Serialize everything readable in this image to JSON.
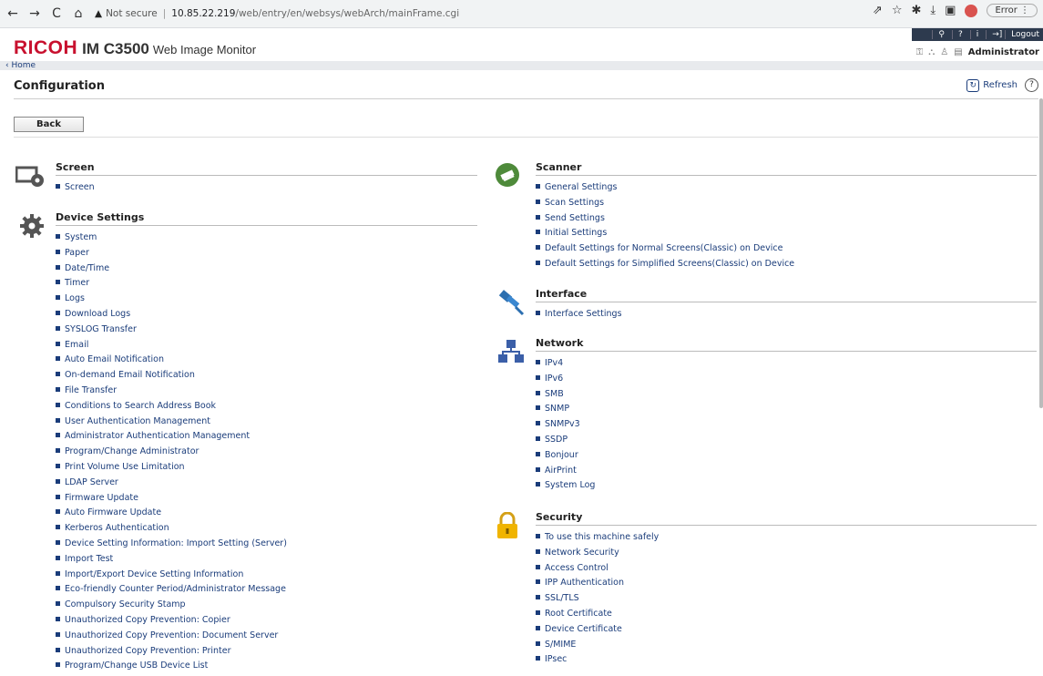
{
  "browser": {
    "not_secure": "Not secure",
    "host": "10.85.22.219",
    "path": "/web/entry/en/websys/webArch/mainFrame.cgi",
    "error_label": "Error"
  },
  "header": {
    "brand": "RICOH",
    "model": "IM C3500",
    "product": "Web Image Monitor",
    "logout": "Logout",
    "user": "Administrator"
  },
  "breadcrumb": "‹ Home",
  "page": {
    "title": "Configuration",
    "refresh": "Refresh",
    "back": "Back"
  },
  "sections": {
    "screen": {
      "title": "Screen",
      "items": [
        "Screen"
      ]
    },
    "device": {
      "title": "Device Settings",
      "items": [
        "System",
        "Paper",
        "Date/Time",
        "Timer",
        "Logs",
        "Download Logs",
        "SYSLOG Transfer",
        "Email",
        "Auto Email Notification",
        "On-demand Email Notification",
        "File Transfer",
        "Conditions to Search Address Book",
        "User Authentication Management",
        "Administrator Authentication Management",
        "Program/Change Administrator",
        "Print Volume Use Limitation",
        "LDAP Server",
        "Firmware Update",
        "Auto Firmware Update",
        "Kerberos Authentication",
        "Device Setting Information: Import Setting (Server)",
        "Import Test",
        "Import/Export Device Setting Information",
        "Eco-friendly Counter Period/Administrator Message",
        "Compulsory Security Stamp",
        "Unauthorized Copy Prevention: Copier",
        "Unauthorized Copy Prevention: Document Server",
        "Unauthorized Copy Prevention: Printer",
        "Program/Change USB Device List"
      ]
    },
    "scanner": {
      "title": "Scanner",
      "items": [
        "General Settings",
        "Scan Settings",
        "Send Settings",
        "Initial Settings",
        "Default Settings for Normal Screens(Classic) on Device",
        "Default Settings for Simplified Screens(Classic) on Device"
      ]
    },
    "interface": {
      "title": "Interface",
      "items": [
        "Interface Settings"
      ]
    },
    "network": {
      "title": "Network",
      "items": [
        "IPv4",
        "IPv6",
        "SMB",
        "SNMP",
        "SNMPv3",
        "SSDP",
        "Bonjour",
        "AirPrint",
        "System Log"
      ]
    },
    "security": {
      "title": "Security",
      "items": [
        "To use this machine safely",
        "Network Security",
        "Access Control",
        "IPP Authentication",
        "SSL/TLS",
        "Root Certificate",
        "Device Certificate",
        "S/MIME",
        "IPsec"
      ]
    }
  }
}
